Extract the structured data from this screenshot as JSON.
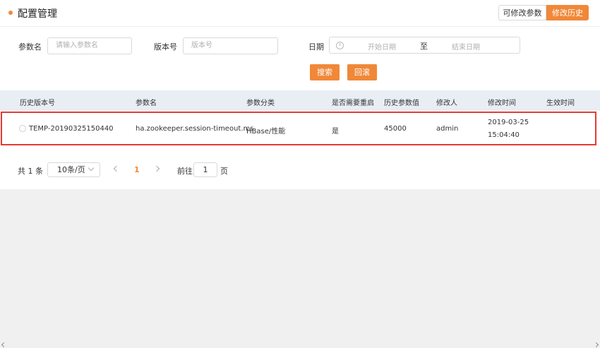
{
  "header": {
    "title": "配置管理",
    "tabs": [
      "可修改参数",
      "修改历史"
    ],
    "accent_color": "#f08838"
  },
  "filters": {
    "param_label": "参数名",
    "param_placeholder": "请输入参数名",
    "version_label": "版本号",
    "version_placeholder": "版本号",
    "date_label": "日期",
    "date_start_placeholder": "开始日期",
    "date_separator": "至",
    "date_end_placeholder": "结束日期",
    "search_button": "搜索",
    "rollback_button": "回滚"
  },
  "table": {
    "columns": [
      "历史版本号",
      "参数名",
      "参数分类",
      "是否需要重启",
      "历史参数值",
      "修改人",
      "修改时间",
      "生效时间"
    ],
    "rows": [
      {
        "version": "TEMP-20190325150440",
        "param": "ha.zookeeper.session-timeout.ms",
        "category": "HBase/性能",
        "restart": "是",
        "value": "45000",
        "modifier": "admin",
        "modified_date": "2019-03-25",
        "modified_time": "15:04:40",
        "effective_time": ""
      }
    ],
    "highlight_color": "#e53935"
  },
  "pagination": {
    "total": "共 1 条",
    "page_size": "10条/页",
    "current_page": "1",
    "goto_label": "前往",
    "goto_value": "1",
    "goto_unit": "页"
  }
}
